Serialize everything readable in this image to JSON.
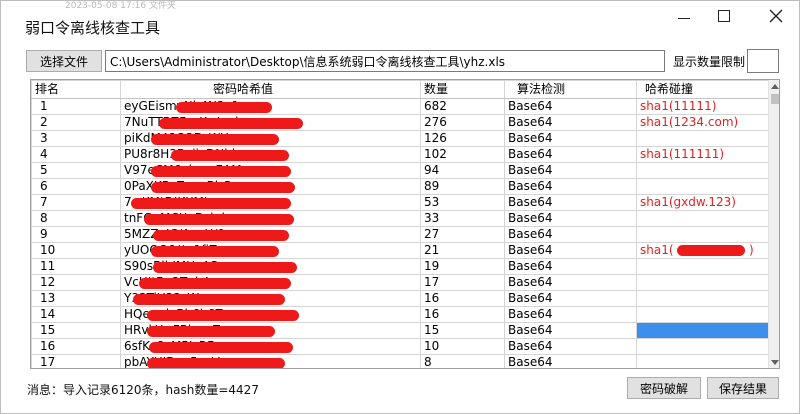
{
  "window": {
    "title": "弱口令离线核查工具",
    "ghost_text": "2023-05-08 17:16  文件夹"
  },
  "toolbar": {
    "select_file_label": "选择文件",
    "file_path": "C:\\Users\\Administrator\\Desktop\\信息系统弱口令离线核查工具\\yhz.xls",
    "limit_label": "显示数量限制",
    "limit_value": ""
  },
  "table": {
    "columns": [
      "排名",
      "密码哈希值",
      "数量",
      "算法检测",
      "哈希碰撞"
    ],
    "rows": [
      {
        "rank": "1",
        "hash": "eyGEismvNb4N2y1",
        "count": "682",
        "algo": "Base64",
        "collision": "sha1(11111)"
      },
      {
        "rank": "2",
        "hash": "7NuTTBZFyvKwLml",
        "count": "276",
        "algo": "Base64",
        "collision": "sha1(1234.com)"
      },
      {
        "rank": "3",
        "hash": "piKdM48CODrK/U",
        "count": "126",
        "algo": "Base64",
        "collision": ""
      },
      {
        "rank": "4",
        "hash": "PU8r8H3BvjiyDNbk",
        "count": "102",
        "algo": "Base64",
        "collision": "sha1(111111)"
      },
      {
        "rank": "5",
        "hash": "V97eCM6ekw+EAM",
        "count": "94",
        "algo": "Base64",
        "collision": ""
      },
      {
        "rank": "6",
        "hash": "0PaXK5yZcggBhG",
        "count": "89",
        "algo": "Base64",
        "collision": ""
      },
      {
        "rank": "7",
        "hash": "7+KMtDIKXMIq",
        "count": "53",
        "algo": "Base64",
        "collision": "sha1(gxdw.123)"
      },
      {
        "rank": "8",
        "hash": "tnFGqMCXqDzkd",
        "count": "33",
        "algo": "Base64",
        "collision": ""
      },
      {
        "rank": "9",
        "hash": "5MZZnIC/AucH/9",
        "count": "27",
        "algo": "Base64",
        "collision": ""
      },
      {
        "rank": "10",
        "hash": "yUOOQ0//w1fjZ",
        "count": "21",
        "algo": "Base64",
        "collision": "sha1("
      },
      {
        "rank": "11",
        "hash": "S90sBlbIMUvAS",
        "count": "19",
        "algo": "Base64",
        "collision": ""
      },
      {
        "rank": "12",
        "hash": "VcHItFgQTqbA",
        "count": "17",
        "algo": "Base64",
        "collision": ""
      },
      {
        "rank": "13",
        "hash": "Y33TiU32sWq",
        "count": "16",
        "algo": "Base64",
        "collision": ""
      },
      {
        "rank": "14",
        "hash": "HQemdxBh6b6Z",
        "count": "16",
        "algo": "Base64",
        "collision": ""
      },
      {
        "rank": "15",
        "hash": "HRvkY+FBlsopZ",
        "count": "15",
        "algo": "Base64",
        "collision": ""
      },
      {
        "rank": "16",
        "hash": "6sfKo8cM5IsRF",
        "count": "10",
        "algo": "Base64",
        "collision": ""
      },
      {
        "rank": "17",
        "hash": "pbAYUIDvp5qzV",
        "count": "8",
        "algo": "Base64",
        "collision": ""
      }
    ],
    "selected_row_index": 14
  },
  "status": {
    "text": "消息：导入记录6120条，hash数量=4427"
  },
  "buttons": {
    "crack_label": "密码破解",
    "save_label": "保存结果"
  },
  "colors": {
    "collision_text": "#e62020",
    "selection": "#3c8fea",
    "redaction": "#ee1a1a"
  }
}
